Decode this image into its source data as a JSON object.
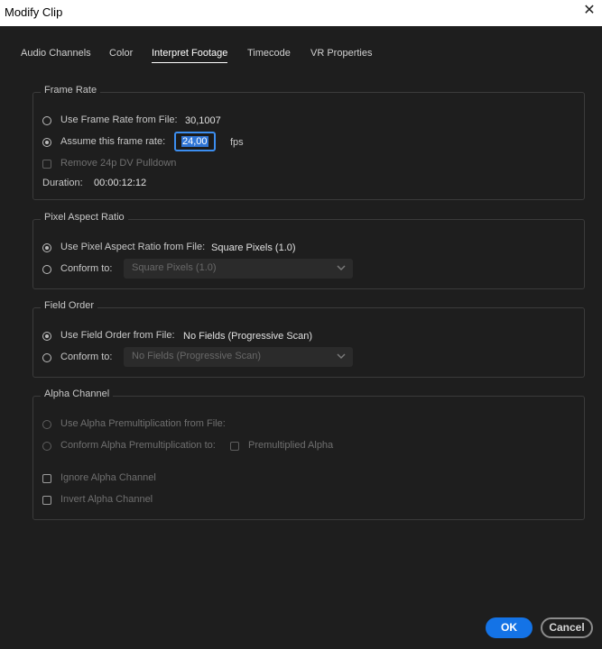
{
  "window": {
    "title": "Modify Clip",
    "close_icon": "close-icon"
  },
  "tabs": [
    {
      "label": "Audio Channels"
    },
    {
      "label": "Color"
    },
    {
      "label": "Interpret Footage",
      "active": true
    },
    {
      "label": "Timecode"
    },
    {
      "label": "VR Properties"
    }
  ],
  "frame_rate": {
    "legend": "Frame Rate",
    "use_from_file_label": "Use Frame Rate from File:",
    "use_from_file_value": "30,1007",
    "assume_label": "Assume this frame rate:",
    "assume_value": "24,00",
    "fps_unit": "fps",
    "remove_pulldown_label": "Remove 24p DV Pulldown",
    "duration_label": "Duration:",
    "duration_value": "00:00:12:12"
  },
  "pixel_aspect_ratio": {
    "legend": "Pixel Aspect Ratio",
    "use_from_file_label": "Use Pixel Aspect Ratio from File:",
    "use_from_file_value": "Square Pixels (1.0)",
    "conform_label": "Conform to:",
    "conform_selected": "Square Pixels (1.0)"
  },
  "field_order": {
    "legend": "Field Order",
    "use_from_file_label": "Use Field Order from File:",
    "use_from_file_value": "No Fields (Progressive Scan)",
    "conform_label": "Conform to:",
    "conform_selected": "No Fields (Progressive Scan)"
  },
  "alpha_channel": {
    "legend": "Alpha Channel",
    "use_premult_label": "Use Alpha Premultiplication from File:",
    "conform_premult_label": "Conform Alpha Premultiplication to:",
    "premultiplied_label": "Premultiplied Alpha",
    "ignore_label": "Ignore Alpha Channel",
    "invert_label": "Invert Alpha Channel"
  },
  "buttons": {
    "ok": "OK",
    "cancel": "Cancel"
  },
  "colors": {
    "accent": "#1473e6",
    "background": "#1e1e1e",
    "focus": "#3c8ef0"
  }
}
